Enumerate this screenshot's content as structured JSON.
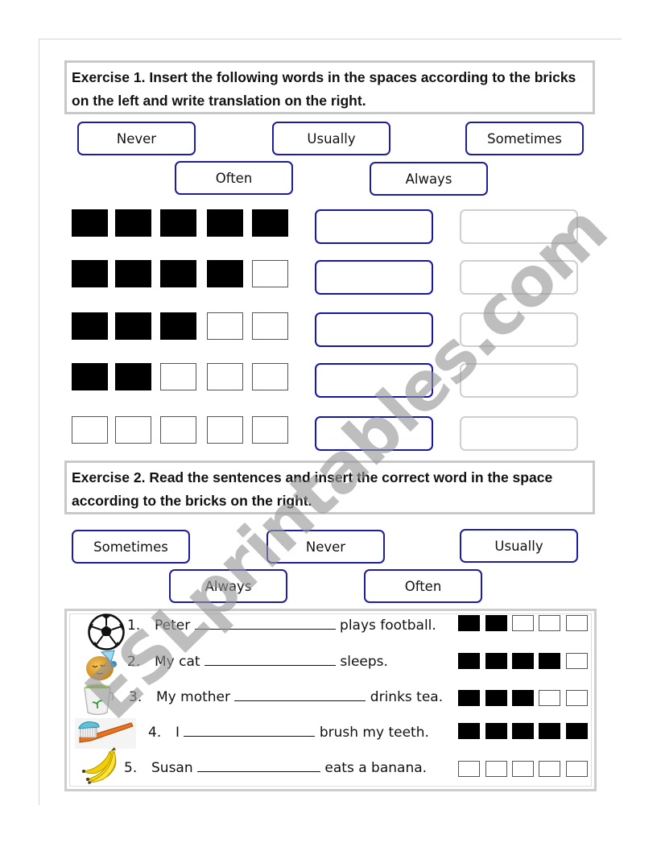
{
  "exercise1": {
    "instruction": "Exercise 1. Insert the following words in the spaces according to the bricks on the left and write translation on the right.",
    "word_bank": [
      "Never",
      "Usually",
      "Sometimes",
      "Often",
      "Always"
    ],
    "brick_rows": [
      {
        "filled": 5,
        "total": 5
      },
      {
        "filled": 4,
        "total": 5
      },
      {
        "filled": 3,
        "total": 5
      },
      {
        "filled": 2,
        "total": 5
      },
      {
        "filled": 0,
        "total": 5
      }
    ],
    "answer_boxes": [
      "",
      "",
      "",
      "",
      ""
    ],
    "translation_boxes": [
      "",
      "",
      "",
      "",
      ""
    ]
  },
  "exercise2": {
    "instruction": "Exercise 2. Read the sentences and insert the correct word in the space according to the bricks on the right.",
    "word_bank": [
      "Sometimes",
      "Never",
      "Usually",
      "Always",
      "Often"
    ],
    "sentences": [
      {
        "number": "1.",
        "before": "Peter",
        "after": "plays football.",
        "icon": "soccer-ball-icon",
        "filled": 2,
        "total": 5
      },
      {
        "number": "2.",
        "before": "My cat",
        "after": "sleeps.",
        "icon": "sleeping-face-icon",
        "filled": 4,
        "total": 5
      },
      {
        "number": "3.",
        "before": "My mother",
        "after": "drinks tea.",
        "icon": "tea-cup-icon",
        "filled": 3,
        "total": 5
      },
      {
        "number": "4.",
        "before": "I",
        "after": "brush my teeth.",
        "icon": "toothbrush-icon",
        "filled": 5,
        "total": 5
      },
      {
        "number": "5.",
        "before": "Susan",
        "after": "eats a banana.",
        "icon": "banana-icon",
        "filled": 0,
        "total": 5
      }
    ]
  },
  "watermark": "ESLprintables.com",
  "colors": {
    "word_box_border": "#1d1d9e",
    "answer_box_border": "#1616a8",
    "translation_box_border": "#cfcfcf",
    "brick_filled": "#000000",
    "watermark": "#969696"
  }
}
